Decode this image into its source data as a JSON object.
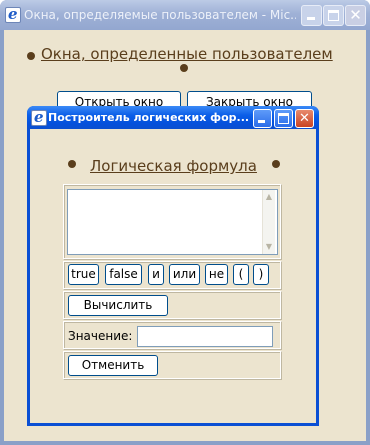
{
  "outer_window": {
    "title": "Окна, определяемые пользователем - Mic...",
    "heading_link": "Окна, определенные пользователем",
    "open_button": "Открыть окно",
    "close_button": "Закрыть окно"
  },
  "inner_window": {
    "title": "Построитель логических фор...",
    "heading_link": "Логическая формула",
    "formula_value": "",
    "operators": [
      "true",
      "false",
      "и",
      "или",
      "не",
      "(",
      ")"
    ],
    "calculate_button": "Вычислить",
    "value_label": "Значение:",
    "value_field": "",
    "cancel_button": "Отменить"
  },
  "icons": {
    "app": "internet-explorer-icon",
    "minimize": "minimize-icon",
    "maximize": "maximize-icon",
    "close": "close-icon",
    "bullet": "bullet-icon"
  },
  "colors": {
    "inactive_titlebar": "#9fb1d6",
    "active_titlebar": "#0b5ee8",
    "page_background": "#ece4cf",
    "link_color": "#5a3e1c",
    "close_button": "#c94323"
  }
}
